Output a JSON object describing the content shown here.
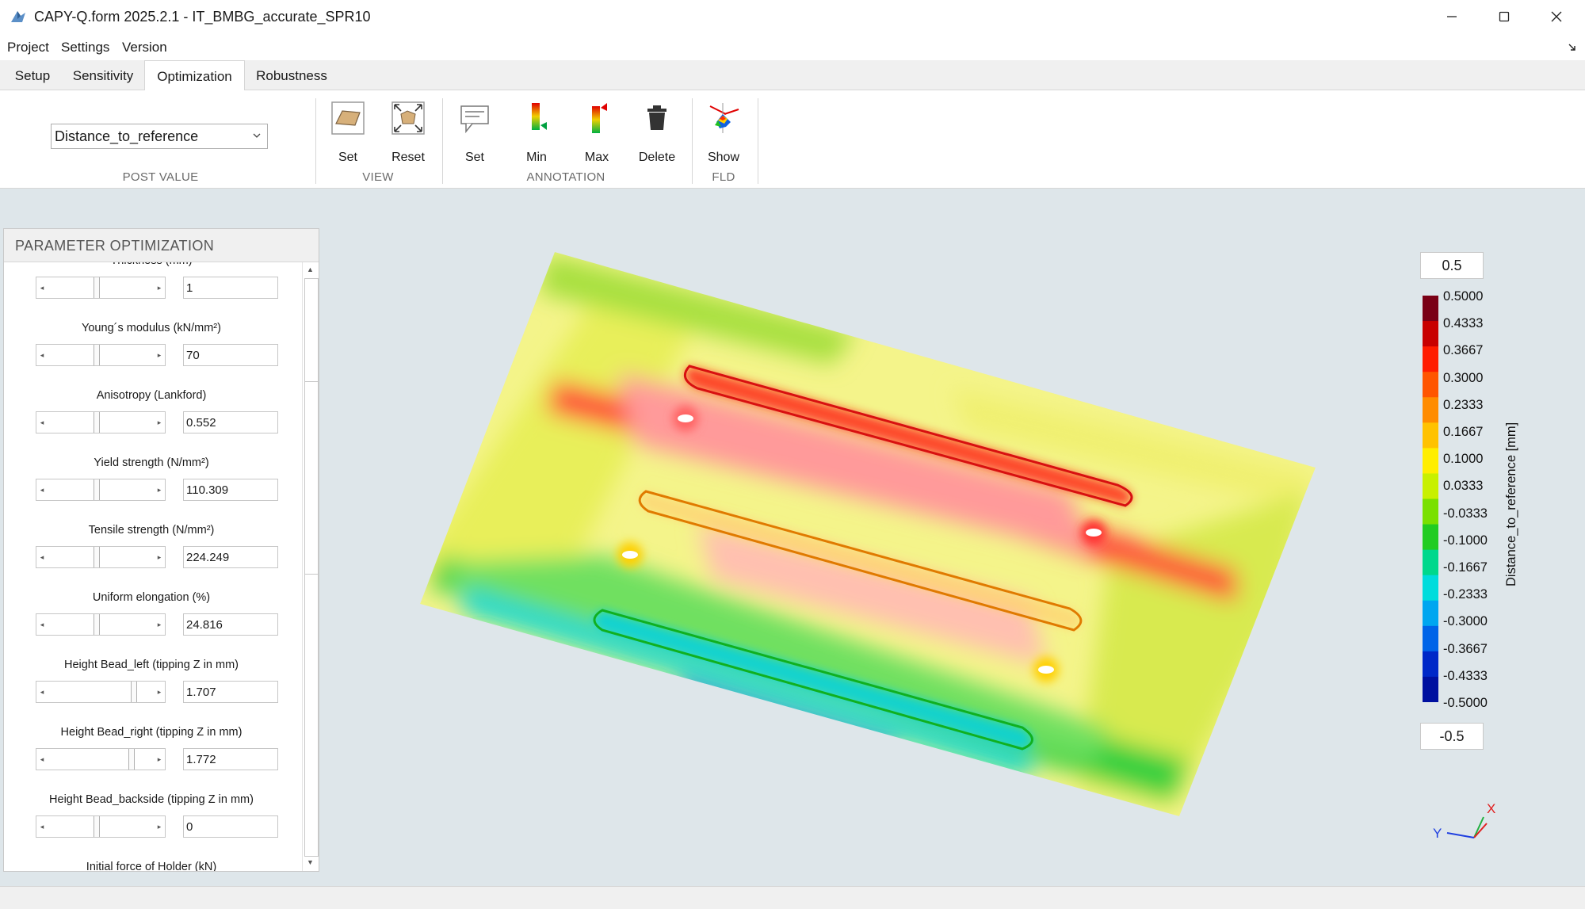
{
  "window": {
    "title": "CAPY-Q.form 2025.2.1 - IT_BMBG_accurate_SPR10"
  },
  "menu": {
    "items": [
      "Project",
      "Settings",
      "Version"
    ]
  },
  "tabs": [
    {
      "label": "Setup",
      "active": false
    },
    {
      "label": "Sensitivity",
      "active": false
    },
    {
      "label": "Optimization",
      "active": true
    },
    {
      "label": "Robustness",
      "active": false
    }
  ],
  "ribbon": {
    "post_value": {
      "selected": "Distance_to_reference",
      "group_label": "POST VALUE"
    },
    "view": {
      "group_label": "VIEW",
      "set_label": "Set",
      "reset_label": "Reset"
    },
    "annotation": {
      "group_label": "ANNOTATION",
      "set_label": "Set",
      "min_label": "Min",
      "max_label": "Max",
      "delete_label": "Delete"
    },
    "fld": {
      "group_label": "FLD",
      "show_label": "Show"
    }
  },
  "panel": {
    "title": "PARAMETER OPTIMIZATION",
    "params": [
      {
        "label": "Thickness (mm)",
        "value": "1",
        "fraction": 0.45
      },
      {
        "label": "Young´s modulus (kN/mm²)",
        "value": "70",
        "fraction": 0.45
      },
      {
        "label": "Anisotropy (Lankford)",
        "value": "0.552",
        "fraction": 0.45
      },
      {
        "label": "Yield strength (N/mm²)",
        "value": "110.309",
        "fraction": 0.45
      },
      {
        "label": "Tensile strength (N/mm²)",
        "value": "224.249",
        "fraction": 0.45
      },
      {
        "label": "Uniform elongation (%)",
        "value": "24.816",
        "fraction": 0.45
      },
      {
        "label": "Height Bead_left (tipping Z in mm)",
        "value": "1.707",
        "fraction": 0.82
      },
      {
        "label": "Height Bead_right (tipping Z in mm)",
        "value": "1.772",
        "fraction": 0.8
      },
      {
        "label": "Height Bead_backside (tipping Z in mm)",
        "value": "0",
        "fraction": 0.45
      },
      {
        "label": "Initial force of Holder (kN)",
        "value": "",
        "fraction": 0.45
      }
    ]
  },
  "legend": {
    "max_input": "0.5",
    "min_input": "-0.5",
    "title": "Distance_to_reference [mm]",
    "ticks": [
      "0.5000",
      "0.4333",
      "0.3667",
      "0.3000",
      "0.2333",
      "0.1667",
      "0.1000",
      "0.0333",
      "-0.0333",
      "-0.1000",
      "-0.1667",
      "-0.2333",
      "-0.3000",
      "-0.3667",
      "-0.4333",
      "-0.5000"
    ],
    "colors": [
      "#7a0016",
      "#c80000",
      "#ff1c00",
      "#ff5500",
      "#ff8c00",
      "#ffc200",
      "#ffee00",
      "#c8f000",
      "#7ae000",
      "#22cc22",
      "#00d88c",
      "#00dcdc",
      "#00a6f0",
      "#0064e8",
      "#0028c8",
      "#0010a0"
    ]
  },
  "axes": {
    "x_label": "X",
    "y_label": "Y"
  }
}
